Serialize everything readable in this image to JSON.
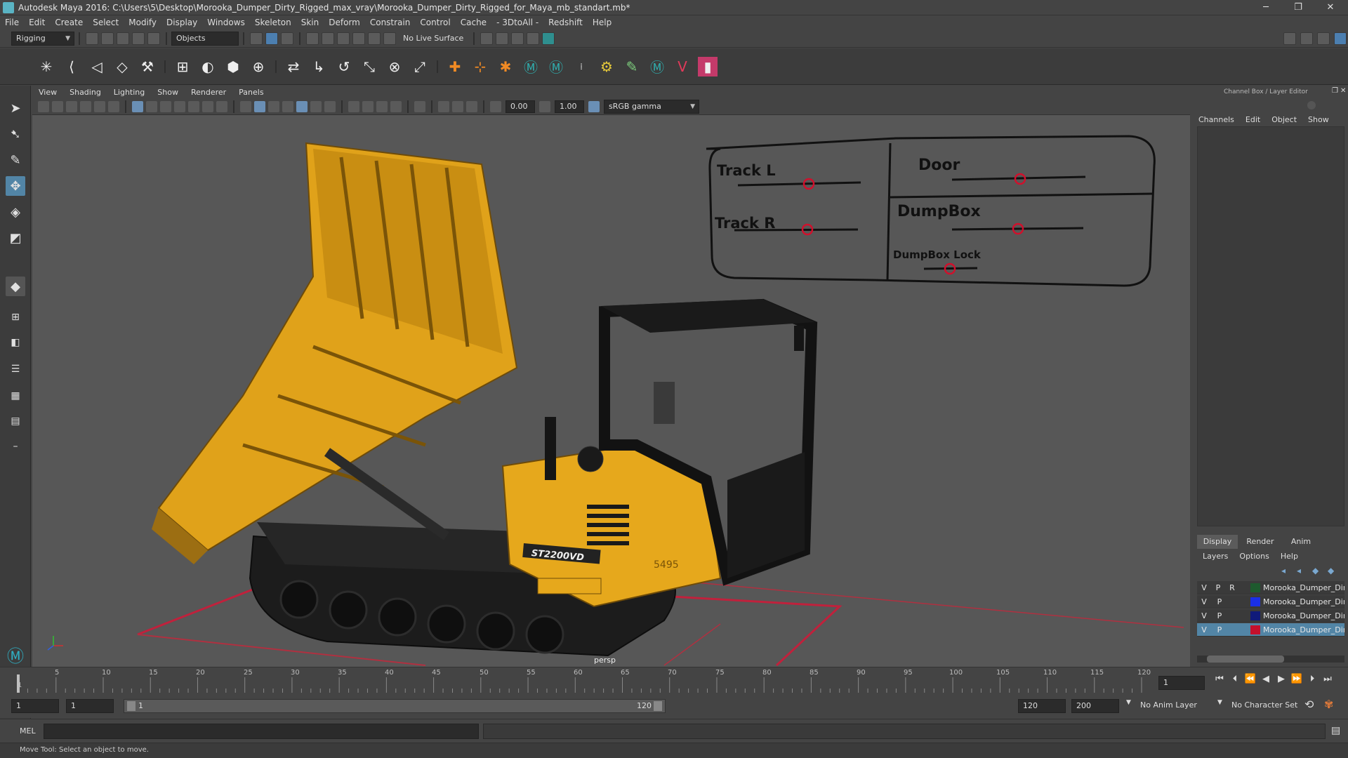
{
  "window": {
    "title": "Autodesk Maya 2016: C:\\Users\\5\\Desktop\\Morooka_Dumper_Dirty_Rigged_max_vray\\Morooka_Dumper_Dirty_Rigged_for_Maya_mb_standart.mb*",
    "minimize": "─",
    "maximize": "❐",
    "close": "✕"
  },
  "menubar": [
    "File",
    "Edit",
    "Create",
    "Select",
    "Modify",
    "Display",
    "Windows",
    "Skeleton",
    "Skin",
    "Deform",
    "Constrain",
    "Control",
    "Cache",
    "- 3DtoAll -",
    "Redshift",
    "Help"
  ],
  "statusline": {
    "menuset": "Rigging",
    "selection_mode": "Objects",
    "live_surface": "No Live Surface"
  },
  "panel": {
    "menus": [
      "View",
      "Shading",
      "Lighting",
      "Show",
      "Renderer",
      "Panels"
    ],
    "exposure": "0.00",
    "gamma": "1.00",
    "colorspace": "sRGB gamma",
    "camera": "persp"
  },
  "rig_controls": {
    "track_l": "Track L",
    "track_r": "Track R",
    "door": "Door",
    "dumpbox": "DumpBox",
    "dumpbox_lock": "DumpBox Lock"
  },
  "decals": {
    "model": "ST2200VD",
    "number": "5495"
  },
  "channelbox": {
    "header": "Channel Box / Layer Editor",
    "menus": [
      "Channels",
      "Edit",
      "Object",
      "Show"
    ],
    "tabs": [
      "Display",
      "Render",
      "Anim"
    ],
    "layer_menus": [
      "Layers",
      "Options",
      "Help"
    ],
    "layers": [
      {
        "v": "V",
        "p": "P",
        "r": "R",
        "name": "Morooka_Dumper_Dirty",
        "color": "#1e5a2e"
      },
      {
        "v": "V",
        "p": "P",
        "r": "",
        "name": "Morooka_Dumper_Dir",
        "color": "#1a2fe6"
      },
      {
        "v": "V",
        "p": "P",
        "r": "",
        "name": "Morooka_Dumper_Dir",
        "color": "#101a7a"
      },
      {
        "v": "V",
        "p": "P",
        "r": "",
        "name": "Morooka_Dumper_Dir",
        "color": "#c4102c"
      }
    ]
  },
  "timeline": {
    "ticks": [
      "1",
      "5",
      "10",
      "15",
      "20",
      "25",
      "30",
      "35",
      "40",
      "45",
      "50",
      "55",
      "60",
      "65",
      "70",
      "75",
      "80",
      "85",
      "90",
      "95",
      "100",
      "105",
      "110",
      "115",
      "120"
    ],
    "current_frame": "1",
    "range_start": "1",
    "playback_start": "1",
    "range_bar_start": "1",
    "range_bar_end": "120",
    "playback_end": "120",
    "range_end": "200",
    "anim_layer": "No Anim Layer",
    "character_set": "No Character Set"
  },
  "cmdline": {
    "label": "MEL"
  },
  "helpline": {
    "text": "Move Tool: Select an object to move."
  }
}
